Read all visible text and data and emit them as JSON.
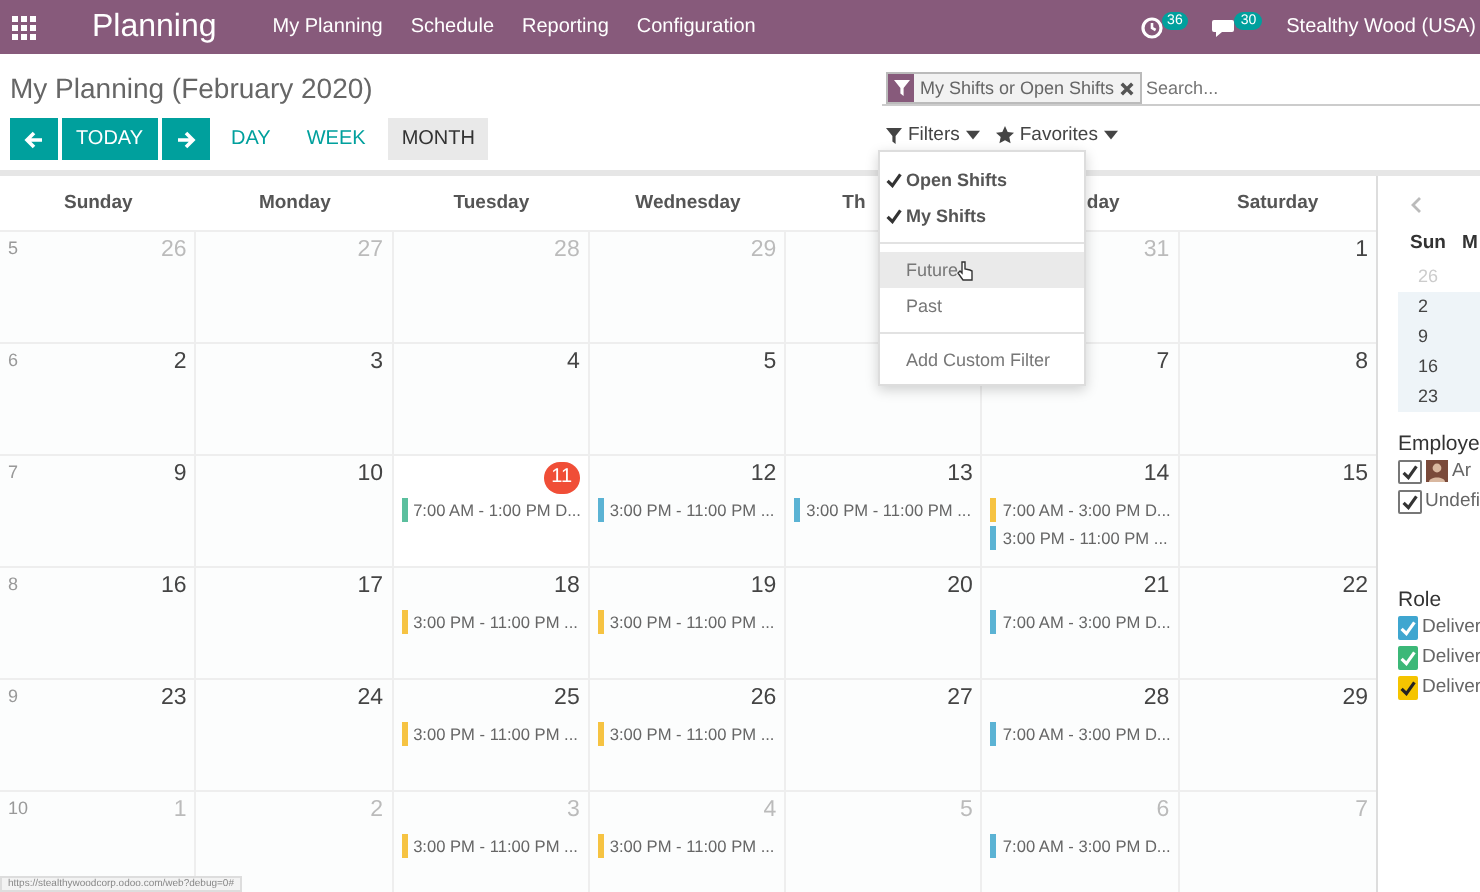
{
  "navbar": {
    "app_name": "Planning",
    "menu": [
      "My Planning",
      "Schedule",
      "Reporting",
      "Configuration"
    ],
    "activity_badge": "36",
    "messages_badge": "30",
    "user": "Stealthy Wood (USA)"
  },
  "control_panel": {
    "title": "My Planning (February 2020)",
    "search": {
      "facet": "My Shifts or Open Shifts",
      "placeholder": "Search..."
    },
    "today_label": "TODAY",
    "scales": [
      {
        "label": "DAY",
        "selected": false
      },
      {
        "label": "WEEK",
        "selected": false
      },
      {
        "label": "MONTH",
        "selected": true
      }
    ],
    "filters_label": "Filters",
    "favorites_label": "Favorites"
  },
  "filters_menu": [
    {
      "kind": "option",
      "label": "Open Shifts",
      "checked": true,
      "hovered": false
    },
    {
      "kind": "option",
      "label": "My Shifts",
      "checked": true,
      "hovered": false
    },
    {
      "kind": "divider"
    },
    {
      "kind": "option",
      "label": "Future",
      "checked": false,
      "hovered": true
    },
    {
      "kind": "option",
      "label": "Past",
      "checked": false,
      "hovered": false
    },
    {
      "kind": "divider"
    },
    {
      "kind": "custom",
      "label": "Add Custom Filter"
    }
  ],
  "calendar": {
    "weekdays": [
      "Sunday",
      "Monday",
      "Tuesday",
      "Wednesday",
      "Th",
      "day",
      "Saturday"
    ],
    "weeks": [
      {
        "number": "5",
        "days": [
          {
            "kind": "day",
            "day": "26",
            "outside": true,
            "today": false
          },
          {
            "kind": "day",
            "day": "27",
            "outside": true,
            "today": false
          },
          {
            "kind": "day",
            "day": "28",
            "outside": true,
            "today": false
          },
          {
            "kind": "day",
            "day": "29",
            "outside": true,
            "today": false
          },
          {
            "kind": "covered"
          },
          {
            "kind": "day",
            "day": "31",
            "outside": true,
            "today": false
          },
          {
            "kind": "day",
            "day": "1",
            "outside": false,
            "today": false
          }
        ]
      },
      {
        "number": "6",
        "days": [
          {
            "kind": "day",
            "day": "2",
            "outside": false,
            "today": false
          },
          {
            "kind": "day",
            "day": "3",
            "outside": false,
            "today": false
          },
          {
            "kind": "day",
            "day": "4",
            "outside": false,
            "today": false
          },
          {
            "kind": "day",
            "day": "5",
            "outside": false,
            "today": false
          },
          {
            "kind": "covered"
          },
          {
            "kind": "day",
            "day": "7",
            "outside": false,
            "today": false
          },
          {
            "kind": "day",
            "day": "8",
            "outside": false,
            "today": false
          }
        ]
      },
      {
        "number": "7",
        "days": [
          {
            "kind": "day",
            "day": "9",
            "outside": false,
            "today": false
          },
          {
            "kind": "day",
            "day": "10",
            "outside": false,
            "today": false
          },
          {
            "kind": "day",
            "day": "11",
            "outside": false,
            "today": true,
            "events": [
              {
                "label": "7:00 AM - 1:00 PM D...",
                "color": "#5bbf9e"
              }
            ]
          },
          {
            "kind": "day",
            "day": "12",
            "outside": false,
            "today": false,
            "events": [
              {
                "label": "3:00 PM - 11:00 PM ...",
                "color": "#5bb3d4"
              }
            ]
          },
          {
            "kind": "day",
            "day": "13",
            "outside": false,
            "today": false,
            "events": [
              {
                "label": "3:00 PM - 11:00 PM ...",
                "color": "#5bb3d4"
              }
            ]
          },
          {
            "kind": "day",
            "day": "14",
            "outside": false,
            "today": false,
            "events": [
              {
                "label": "7:00 AM - 3:00 PM D...",
                "color": "#f6c342"
              },
              {
                "label": "3:00 PM - 11:00 PM ...",
                "color": "#5bb3d4"
              }
            ]
          },
          {
            "kind": "day",
            "day": "15",
            "outside": false,
            "today": false
          }
        ]
      },
      {
        "number": "8",
        "days": [
          {
            "kind": "day",
            "day": "16",
            "outside": false,
            "today": false
          },
          {
            "kind": "day",
            "day": "17",
            "outside": false,
            "today": false
          },
          {
            "kind": "day",
            "day": "18",
            "outside": false,
            "today": false,
            "events": [
              {
                "label": "3:00 PM - 11:00 PM ...",
                "color": "#f6c342"
              }
            ]
          },
          {
            "kind": "day",
            "day": "19",
            "outside": false,
            "today": false,
            "events": [
              {
                "label": "3:00 PM - 11:00 PM ...",
                "color": "#f6c342"
              }
            ]
          },
          {
            "kind": "day",
            "day": "20",
            "outside": false,
            "today": false
          },
          {
            "kind": "day",
            "day": "21",
            "outside": false,
            "today": false,
            "events": [
              {
                "label": "7:00 AM - 3:00 PM D...",
                "color": "#5bb3d4"
              }
            ]
          },
          {
            "kind": "day",
            "day": "22",
            "outside": false,
            "today": false
          }
        ]
      },
      {
        "number": "9",
        "days": [
          {
            "kind": "day",
            "day": "23",
            "outside": false,
            "today": false
          },
          {
            "kind": "day",
            "day": "24",
            "outside": false,
            "today": false
          },
          {
            "kind": "day",
            "day": "25",
            "outside": false,
            "today": false,
            "events": [
              {
                "label": "3:00 PM - 11:00 PM ...",
                "color": "#f6c342"
              }
            ]
          },
          {
            "kind": "day",
            "day": "26",
            "outside": false,
            "today": false,
            "events": [
              {
                "label": "3:00 PM - 11:00 PM ...",
                "color": "#f6c342"
              }
            ]
          },
          {
            "kind": "day",
            "day": "27",
            "outside": false,
            "today": false
          },
          {
            "kind": "day",
            "day": "28",
            "outside": false,
            "today": false,
            "events": [
              {
                "label": "7:00 AM - 3:00 PM D...",
                "color": "#5bb3d4"
              }
            ]
          },
          {
            "kind": "day",
            "day": "29",
            "outside": false,
            "today": false
          }
        ]
      },
      {
        "number": "10",
        "days": [
          {
            "kind": "day",
            "day": "1",
            "outside": true,
            "today": false
          },
          {
            "kind": "day",
            "day": "2",
            "outside": true,
            "today": false
          },
          {
            "kind": "day",
            "day": "3",
            "outside": true,
            "today": false,
            "events": [
              {
                "label": "3:00 PM - 11:00 PM ...",
                "color": "#f6c342"
              }
            ]
          },
          {
            "kind": "day",
            "day": "4",
            "outside": true,
            "today": false,
            "events": [
              {
                "label": "3:00 PM - 11:00 PM ...",
                "color": "#f6c342"
              }
            ]
          },
          {
            "kind": "day",
            "day": "5",
            "outside": true,
            "today": false
          },
          {
            "kind": "day",
            "day": "6",
            "outside": true,
            "today": false,
            "events": [
              {
                "label": "7:00 AM - 3:00 PM D...",
                "color": "#5bb3d4"
              }
            ]
          },
          {
            "kind": "day",
            "day": "7",
            "outside": true,
            "today": false
          }
        ]
      }
    ]
  },
  "sidebar": {
    "mini_calendar": {
      "weekdays": [
        "Sun",
        "M"
      ],
      "days": [
        {
          "label": "26",
          "outside": true
        },
        {
          "label": "2",
          "outside": false
        },
        {
          "label": "9",
          "outside": false
        },
        {
          "label": "16",
          "outside": false
        },
        {
          "label": "23",
          "outside": false
        }
      ]
    },
    "employee_title": "Employe",
    "employees": [
      {
        "label": "Ar",
        "checked": true,
        "avatar": true
      },
      {
        "label": "Undefi",
        "checked": true,
        "avatar": false
      }
    ],
    "role_title": "Role",
    "roles": [
      {
        "label": "Deliver",
        "checked": true,
        "color": "#3fa6d0"
      },
      {
        "label": "Deliver",
        "checked": true,
        "color": "#3cb878"
      },
      {
        "label": "Deliver",
        "checked": true,
        "color": "#f5c400"
      }
    ]
  },
  "status_url": "https://stealthywoodcorp.odoo.com/web?debug=0#"
}
